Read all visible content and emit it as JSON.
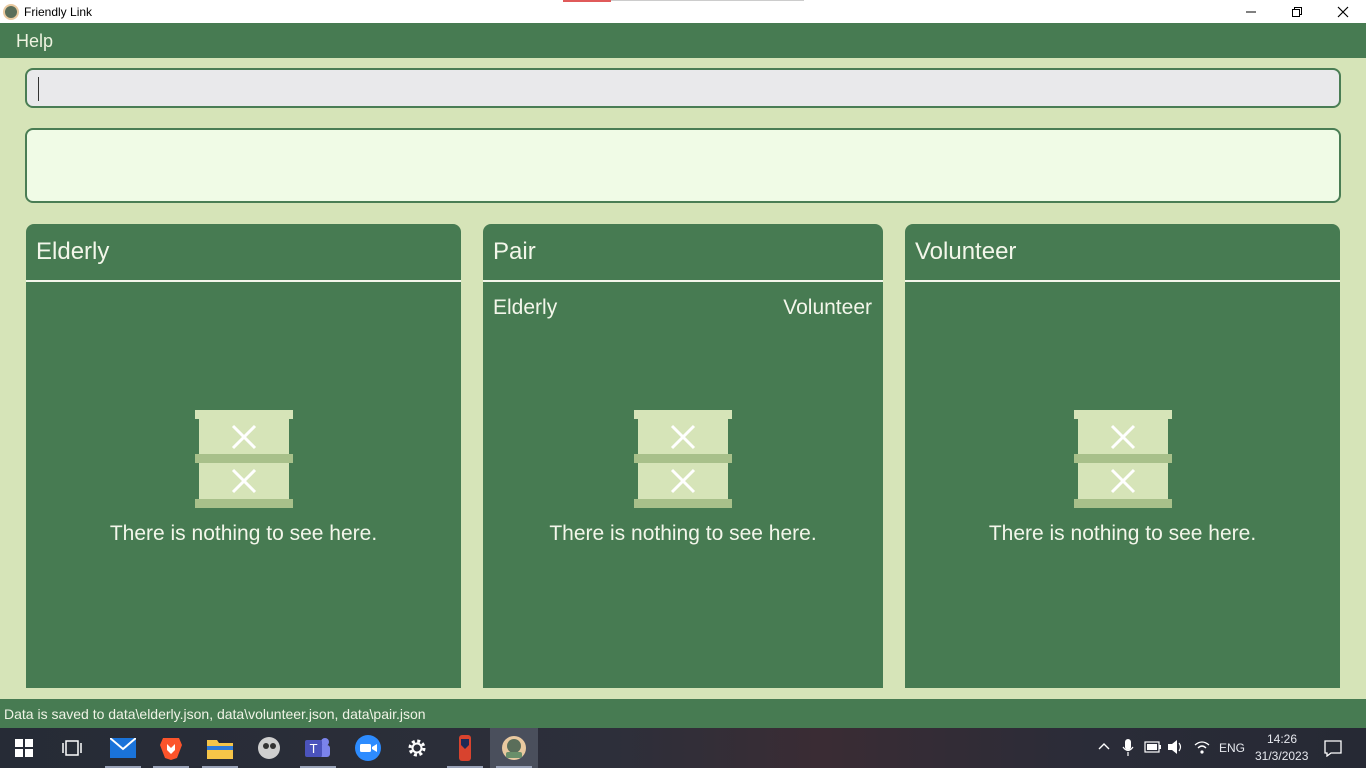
{
  "window": {
    "title": "Friendly Link"
  },
  "menu": {
    "help_label": "Help"
  },
  "command_box": {
    "value": "",
    "placeholder": ""
  },
  "result_display": {
    "text": ""
  },
  "panels": {
    "elderly": {
      "title": "Elderly",
      "empty_text": "There is nothing to see here."
    },
    "pair": {
      "title": "Pair",
      "left_label": "Elderly",
      "right_label": "Volunteer",
      "empty_text": "There is nothing to see here."
    },
    "volunteer": {
      "title": "Volunteer",
      "empty_text": "There is nothing to see here."
    }
  },
  "status_bar": {
    "text": "Data is saved to data\\elderly.json, data\\volunteer.json, data\\pair.json"
  },
  "taskbar": {
    "apps": [
      "start-icon",
      "task-view-icon",
      "mail-icon",
      "brave-icon",
      "file-explorer-icon",
      "app-icon",
      "teams-icon",
      "zoom-icon",
      "settings-icon",
      "app-icon",
      "friendly-link-icon"
    ],
    "language": "ENG",
    "time": "14:26",
    "date": "31/3/2023"
  },
  "colors": {
    "accent": "#477b52",
    "background": "#d6e4b8",
    "result_bg": "#f0fbe6",
    "empty_icon": "#d6e4b8"
  }
}
